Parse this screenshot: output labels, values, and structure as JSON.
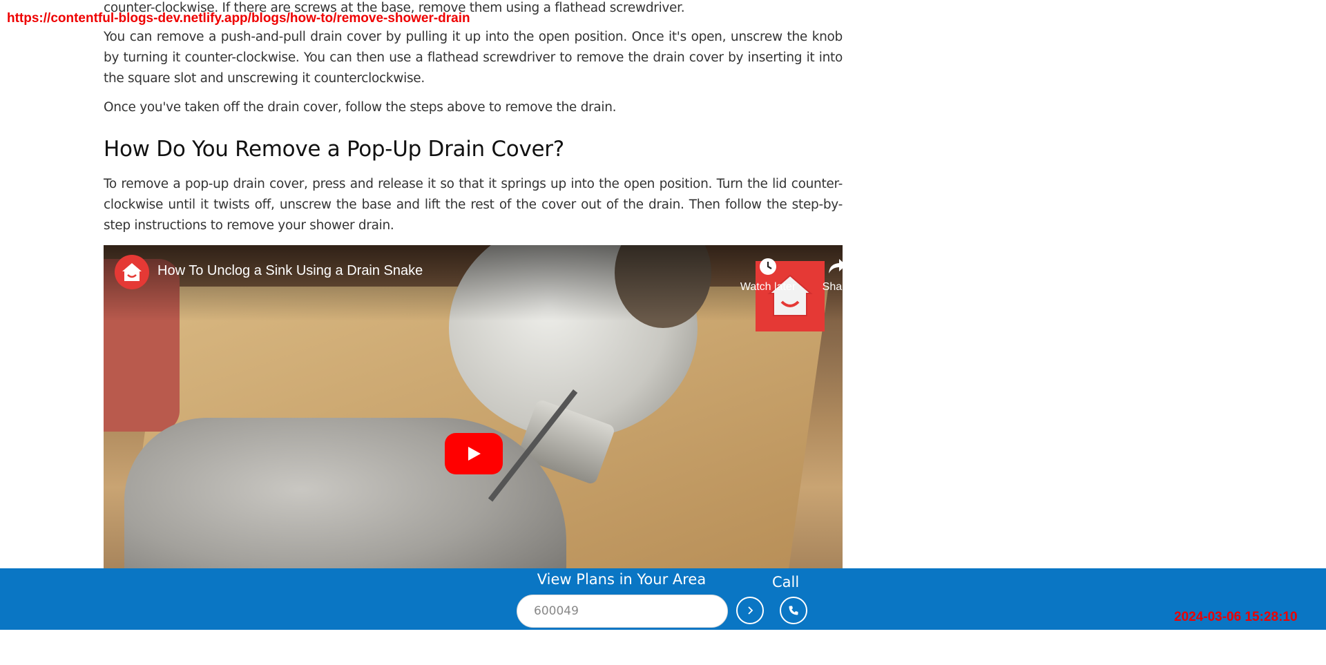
{
  "overlay": {
    "url": "https://contentful-blogs-dev.netlify.app/blogs/how-to/remove-shower-drain",
    "timestamp": "2024-03-06 15:28:10"
  },
  "article": {
    "para_top": "counter-clockwise. If there are screws at the base, remove them using a flathead screwdriver.",
    "para_push_pull": "You can remove a push-and-pull drain cover by pulling it up into the open position. Once it's open, unscrew the knob by turning it counter-clockwise. You can then use a flathead screwdriver to remove the drain cover by inserting it into the square slot and unscrewing it counterclockwise.",
    "para_once": "Once you've taken off the drain cover, follow the steps above to remove the drain.",
    "heading_popup": "How Do You Remove a Pop-Up Drain Cover?",
    "para_popup": "To remove a pop-up drain cover, press and release it so that it springs up into the open position. Turn the lid counter-clockwise until it twists off, unscrew the base and lift the rest of the cover out of the drain. Then follow the step-by-step instructions to remove your shower drain."
  },
  "video": {
    "title": "How To Unclog a Sink Using a Drain Snake",
    "watch_later": "Watch later",
    "share": "Share",
    "icons": [
      "channel-logo-icon",
      "clock-icon",
      "share-icon",
      "play-icon"
    ]
  },
  "plans_bar": {
    "title": "View Plans in Your Area",
    "zip_value": "600049",
    "call_label": "Call",
    "background": "#0a76c4"
  }
}
